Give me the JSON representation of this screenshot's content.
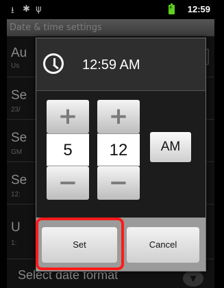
{
  "status_bar": {
    "time": "12:59",
    "icons": [
      "usb-icon",
      "android-debug-icon",
      "usb-tethering-icon",
      "battery-charging-icon"
    ]
  },
  "title_bar": {
    "title": "Date & time settings"
  },
  "background_list": {
    "items": [
      {
        "title_partial": "Au",
        "subtitle_partial": "Us"
      },
      {
        "title_partial": "Se",
        "subtitle_partial": "23/"
      },
      {
        "title_partial": "Se",
        "subtitle_partial": "GM"
      },
      {
        "title_partial": "Se",
        "subtitle_partial": "12:"
      },
      {
        "title_partial": "U",
        "subtitle_partial": "1:"
      }
    ],
    "bottom_item": "Select date format"
  },
  "dialog": {
    "icon": "clock-icon",
    "title": "12:59 AM",
    "hour_value": "5",
    "minute_value": "12",
    "increment_glyph": "+",
    "decrement_glyph": "−",
    "ampm_label": "AM",
    "set_label": "Set",
    "cancel_label": "Cancel"
  },
  "highlight_color": "#ff1a1a"
}
